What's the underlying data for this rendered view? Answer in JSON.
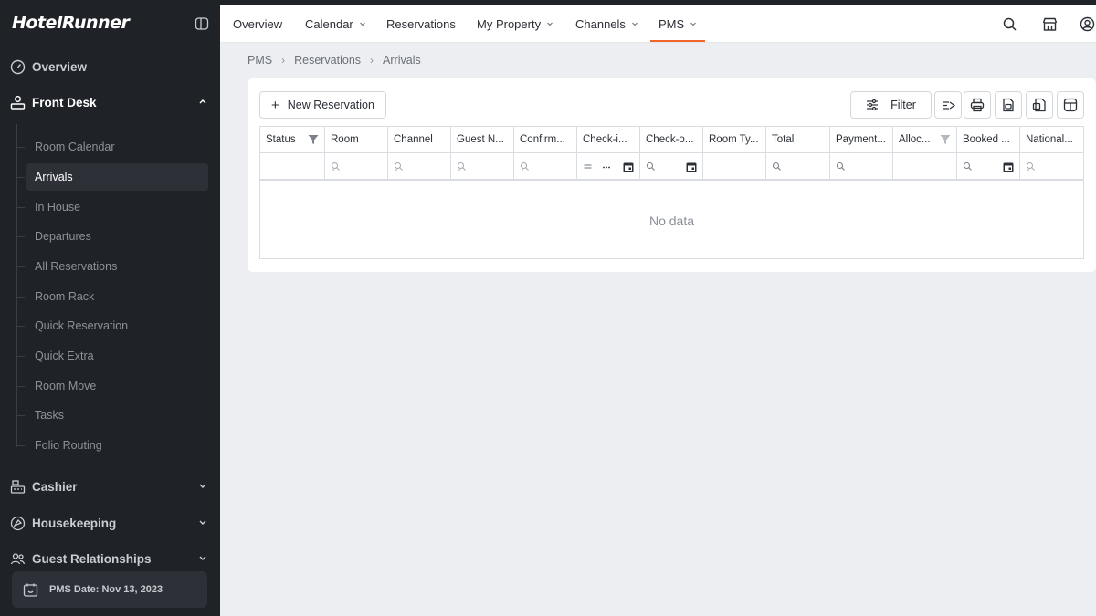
{
  "app": {
    "logo_text": "HotelRunner"
  },
  "sidebar": {
    "top_items": [
      {
        "label": "Overview",
        "icon": "gauge-icon"
      },
      {
        "label": "Front Desk",
        "icon": "front-desk-icon"
      }
    ],
    "front_desk_items": [
      {
        "label": "Room Calendar"
      },
      {
        "label": "Arrivals",
        "active": true
      },
      {
        "label": "In House"
      },
      {
        "label": "Departures"
      },
      {
        "label": "All Reservations"
      },
      {
        "label": "Room Rack"
      },
      {
        "label": "Quick Reservation"
      },
      {
        "label": "Quick Extra"
      },
      {
        "label": "Room Move"
      },
      {
        "label": "Tasks"
      },
      {
        "label": "Folio Routing"
      }
    ],
    "bottom_items": [
      {
        "label": "Cashier",
        "icon": "cash-register-icon"
      },
      {
        "label": "Housekeeping",
        "icon": "housekeeping-icon"
      },
      {
        "label": "Guest Relationships",
        "icon": "guests-icon"
      }
    ],
    "pms_date": "PMS Date: Nov 13, 2023"
  },
  "topnav": {
    "items": [
      {
        "label": "Overview"
      },
      {
        "label": "Calendar"
      },
      {
        "label": "Reservations"
      },
      {
        "label": "My Property"
      },
      {
        "label": "Channels"
      },
      {
        "label": "PMS",
        "active": true
      }
    ]
  },
  "breadcrumb": [
    "PMS",
    "Reservations",
    "Arrivals"
  ],
  "toolbar": {
    "new_reservation": "New Reservation",
    "filter": "Filter"
  },
  "table": {
    "columns": [
      {
        "label": "Status"
      },
      {
        "label": "Room"
      },
      {
        "label": "Channel"
      },
      {
        "label": "Guest N..."
      },
      {
        "label": "Confirm..."
      },
      {
        "label": "Check-i..."
      },
      {
        "label": "Check-o..."
      },
      {
        "label": "Room Ty..."
      },
      {
        "label": "Total"
      },
      {
        "label": "Payment..."
      },
      {
        "label": "Alloc..."
      },
      {
        "label": "Booked ..."
      },
      {
        "label": "National..."
      }
    ],
    "empty_text": "No data"
  },
  "colors": {
    "accent": "#f0662b",
    "sidebar_bg": "#1f2226"
  }
}
